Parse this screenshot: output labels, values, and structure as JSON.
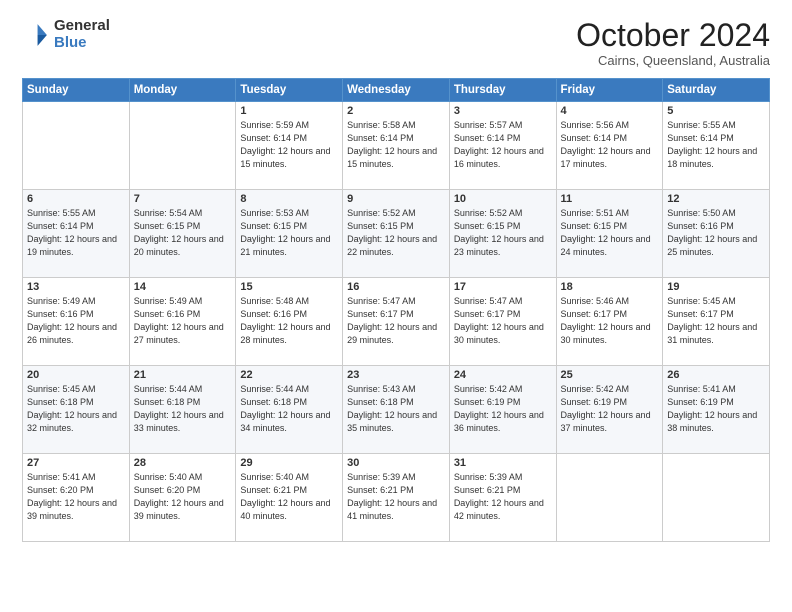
{
  "header": {
    "logo_general": "General",
    "logo_blue": "Blue",
    "month_title": "October 2024",
    "subtitle": "Cairns, Queensland, Australia"
  },
  "weekdays": [
    "Sunday",
    "Monday",
    "Tuesday",
    "Wednesday",
    "Thursday",
    "Friday",
    "Saturday"
  ],
  "weeks": [
    [
      {
        "day": "",
        "info": ""
      },
      {
        "day": "",
        "info": ""
      },
      {
        "day": "1",
        "info": "Sunrise: 5:59 AM\nSunset: 6:14 PM\nDaylight: 12 hours\nand 15 minutes."
      },
      {
        "day": "2",
        "info": "Sunrise: 5:58 AM\nSunset: 6:14 PM\nDaylight: 12 hours\nand 15 minutes."
      },
      {
        "day": "3",
        "info": "Sunrise: 5:57 AM\nSunset: 6:14 PM\nDaylight: 12 hours\nand 16 minutes."
      },
      {
        "day": "4",
        "info": "Sunrise: 5:56 AM\nSunset: 6:14 PM\nDaylight: 12 hours\nand 17 minutes."
      },
      {
        "day": "5",
        "info": "Sunrise: 5:55 AM\nSunset: 6:14 PM\nDaylight: 12 hours\nand 18 minutes."
      }
    ],
    [
      {
        "day": "6",
        "info": "Sunrise: 5:55 AM\nSunset: 6:14 PM\nDaylight: 12 hours\nand 19 minutes."
      },
      {
        "day": "7",
        "info": "Sunrise: 5:54 AM\nSunset: 6:15 PM\nDaylight: 12 hours\nand 20 minutes."
      },
      {
        "day": "8",
        "info": "Sunrise: 5:53 AM\nSunset: 6:15 PM\nDaylight: 12 hours\nand 21 minutes."
      },
      {
        "day": "9",
        "info": "Sunrise: 5:52 AM\nSunset: 6:15 PM\nDaylight: 12 hours\nand 22 minutes."
      },
      {
        "day": "10",
        "info": "Sunrise: 5:52 AM\nSunset: 6:15 PM\nDaylight: 12 hours\nand 23 minutes."
      },
      {
        "day": "11",
        "info": "Sunrise: 5:51 AM\nSunset: 6:15 PM\nDaylight: 12 hours\nand 24 minutes."
      },
      {
        "day": "12",
        "info": "Sunrise: 5:50 AM\nSunset: 6:16 PM\nDaylight: 12 hours\nand 25 minutes."
      }
    ],
    [
      {
        "day": "13",
        "info": "Sunrise: 5:49 AM\nSunset: 6:16 PM\nDaylight: 12 hours\nand 26 minutes."
      },
      {
        "day": "14",
        "info": "Sunrise: 5:49 AM\nSunset: 6:16 PM\nDaylight: 12 hours\nand 27 minutes."
      },
      {
        "day": "15",
        "info": "Sunrise: 5:48 AM\nSunset: 6:16 PM\nDaylight: 12 hours\nand 28 minutes."
      },
      {
        "day": "16",
        "info": "Sunrise: 5:47 AM\nSunset: 6:17 PM\nDaylight: 12 hours\nand 29 minutes."
      },
      {
        "day": "17",
        "info": "Sunrise: 5:47 AM\nSunset: 6:17 PM\nDaylight: 12 hours\nand 30 minutes."
      },
      {
        "day": "18",
        "info": "Sunrise: 5:46 AM\nSunset: 6:17 PM\nDaylight: 12 hours\nand 30 minutes."
      },
      {
        "day": "19",
        "info": "Sunrise: 5:45 AM\nSunset: 6:17 PM\nDaylight: 12 hours\nand 31 minutes."
      }
    ],
    [
      {
        "day": "20",
        "info": "Sunrise: 5:45 AM\nSunset: 6:18 PM\nDaylight: 12 hours\nand 32 minutes."
      },
      {
        "day": "21",
        "info": "Sunrise: 5:44 AM\nSunset: 6:18 PM\nDaylight: 12 hours\nand 33 minutes."
      },
      {
        "day": "22",
        "info": "Sunrise: 5:44 AM\nSunset: 6:18 PM\nDaylight: 12 hours\nand 34 minutes."
      },
      {
        "day": "23",
        "info": "Sunrise: 5:43 AM\nSunset: 6:18 PM\nDaylight: 12 hours\nand 35 minutes."
      },
      {
        "day": "24",
        "info": "Sunrise: 5:42 AM\nSunset: 6:19 PM\nDaylight: 12 hours\nand 36 minutes."
      },
      {
        "day": "25",
        "info": "Sunrise: 5:42 AM\nSunset: 6:19 PM\nDaylight: 12 hours\nand 37 minutes."
      },
      {
        "day": "26",
        "info": "Sunrise: 5:41 AM\nSunset: 6:19 PM\nDaylight: 12 hours\nand 38 minutes."
      }
    ],
    [
      {
        "day": "27",
        "info": "Sunrise: 5:41 AM\nSunset: 6:20 PM\nDaylight: 12 hours\nand 39 minutes."
      },
      {
        "day": "28",
        "info": "Sunrise: 5:40 AM\nSunset: 6:20 PM\nDaylight: 12 hours\nand 39 minutes."
      },
      {
        "day": "29",
        "info": "Sunrise: 5:40 AM\nSunset: 6:21 PM\nDaylight: 12 hours\nand 40 minutes."
      },
      {
        "day": "30",
        "info": "Sunrise: 5:39 AM\nSunset: 6:21 PM\nDaylight: 12 hours\nand 41 minutes."
      },
      {
        "day": "31",
        "info": "Sunrise: 5:39 AM\nSunset: 6:21 PM\nDaylight: 12 hours\nand 42 minutes."
      },
      {
        "day": "",
        "info": ""
      },
      {
        "day": "",
        "info": ""
      }
    ]
  ]
}
